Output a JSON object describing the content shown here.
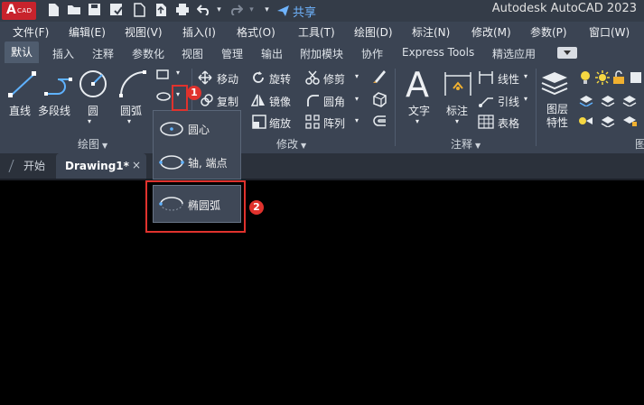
{
  "titlebar": {
    "logo_text": "A",
    "logo_subtext": "CAD",
    "quick_access_icons": [
      "new-file-icon",
      "open-folder-icon",
      "save-icon",
      "save-as-icon",
      "web-save-icon",
      "upload-icon",
      "print-icon",
      "undo-icon",
      "redo-icon",
      "customize-dropdown-icon"
    ],
    "share_label": "共享",
    "window_title": "Autodesk AutoCAD 2023"
  },
  "menubar": {
    "items": [
      "文件(F)",
      "编辑(E)",
      "视图(V)",
      "插入(I)",
      "格式(O)",
      "工具(T)",
      "绘图(D)",
      "标注(N)",
      "修改(M)",
      "参数(P)",
      "窗口(W)"
    ]
  },
  "ribbon_tabs": {
    "items": [
      "默认",
      "插入",
      "注释",
      "参数化",
      "视图",
      "管理",
      "输出",
      "附加模块",
      "协作",
      "Express Tools",
      "精选应用"
    ],
    "active": "默认"
  },
  "draw_panel": {
    "title": "绘图",
    "line": "直线",
    "polyline": "多段线",
    "circle": "圆",
    "arc": "圆弧"
  },
  "modify_panel": {
    "title": "修改",
    "move": "移动",
    "rotate": "旋转",
    "trim": "修剪",
    "copy": "复制",
    "mirror": "镜像",
    "fillet": "圆角",
    "scale": "缩放",
    "array": "阵列"
  },
  "annotation_panel": {
    "title": "注释",
    "text": "文字",
    "dimension": "标注",
    "linear": "线性",
    "leader": "引线",
    "table": "表格"
  },
  "layers_panel": {
    "layer_properties": "图层\n特性",
    "title_partial": "图"
  },
  "file_tabs": {
    "start": "开始",
    "drawing": "Drawing1*",
    "close": "×"
  },
  "ellipse_dropdown": {
    "items": [
      "圆心",
      "轴, 端点",
      "椭圆弧"
    ]
  },
  "annotations": {
    "badge1": "1",
    "badge2": "2"
  },
  "colors": {
    "accent_red": "#e0322d",
    "ribbon_bg": "#3b4453",
    "canvas_bg": "#000000",
    "share_blue": "#6fb4ff"
  }
}
